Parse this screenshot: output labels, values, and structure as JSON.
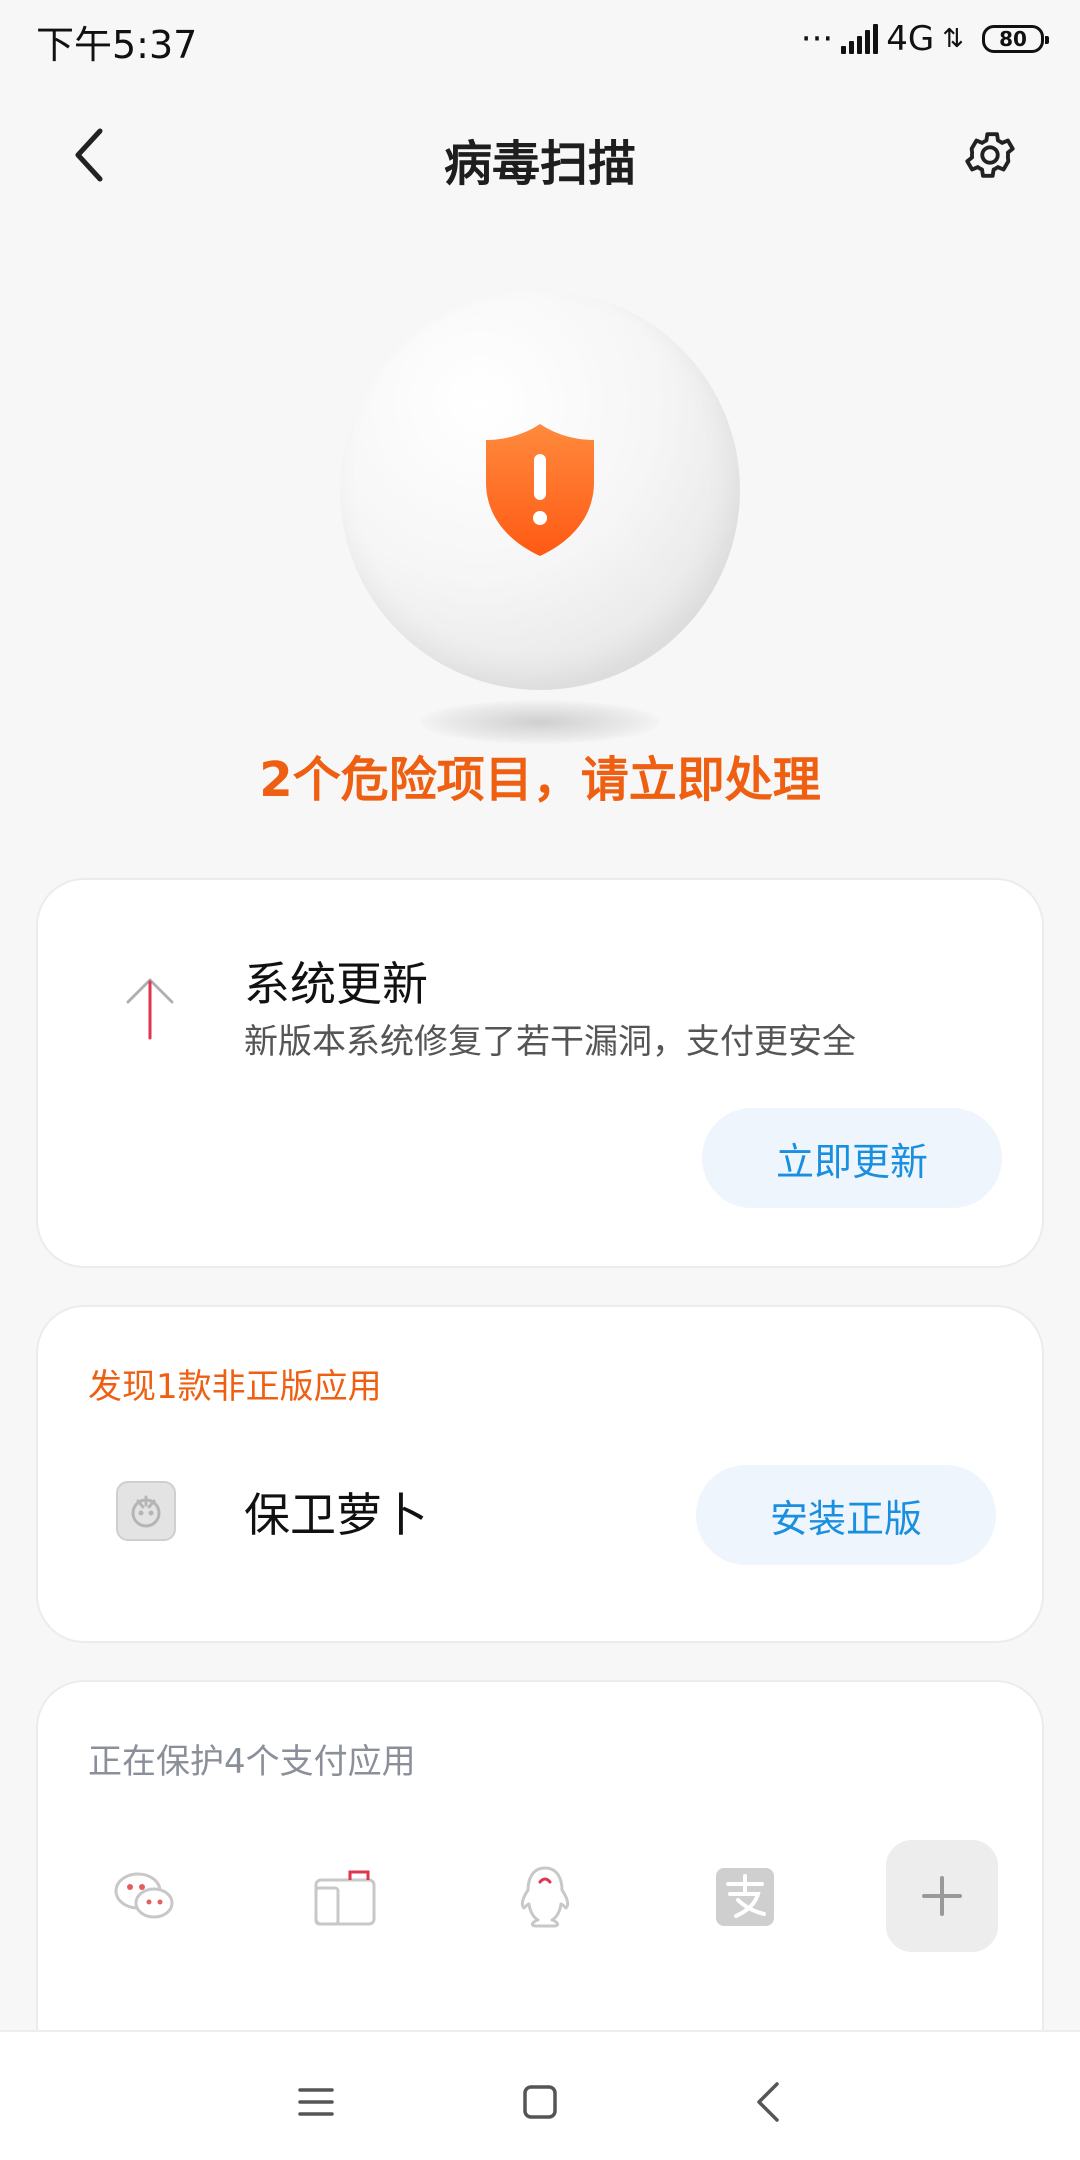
{
  "status_bar": {
    "time": "下午5:37",
    "dots": "···",
    "network": "4G",
    "data_arrows": "⇅",
    "battery": "80"
  },
  "header": {
    "title": "病毒扫描",
    "back_icon": "chevron-left-icon",
    "settings_icon": "gear-icon"
  },
  "hero": {
    "alert": "2个危险项目，请立即处理",
    "shield_color": "#ff6a1f"
  },
  "system_update": {
    "title": "系统更新",
    "description": "新版本系统修复了若干漏洞，支付更安全",
    "button": "立即更新",
    "icon": "arrow-up-icon"
  },
  "pirated_app": {
    "hint": "发现1款非正版应用",
    "app_name": "保卫萝卜",
    "button": "安装正版"
  },
  "payment_protection": {
    "title": "正在保护4个支付应用",
    "apps": [
      "wechat-icon",
      "wallet-icon",
      "qq-icon",
      "alipay-icon"
    ],
    "add_icon": "plus-icon"
  },
  "nav": {
    "menu_icon": "menu-icon",
    "home_icon": "home-square-icon",
    "back_icon": "back-triangle-icon"
  },
  "colors": {
    "accent_orange": "#ef5f11",
    "button_blue": "#1a8fe0",
    "button_bg": "#eef5fc"
  }
}
